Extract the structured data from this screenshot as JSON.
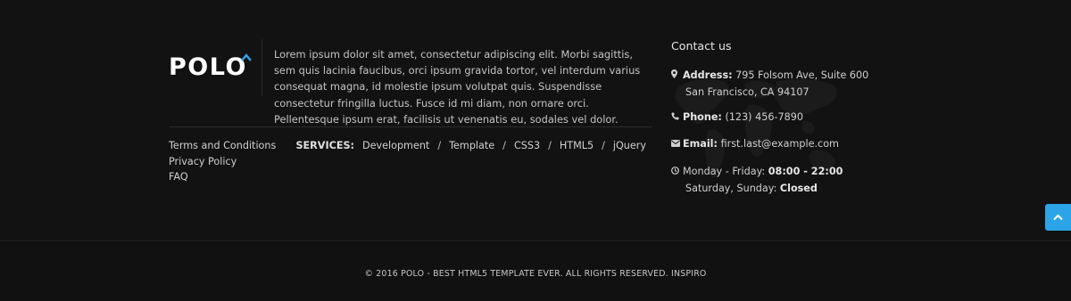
{
  "logo": {
    "text": "POLO",
    "accent_color": "#2ba5e8"
  },
  "about": {
    "text": "Lorem ipsum dolor sit amet, consectetur adipiscing elit. Morbi sagittis, sem quis lacinia faucibus, orci ipsum gravida tortor, vel interdum varius consequat magna, id molestie ipsum volutpat quis. Suspendisse consectetur fringilla luctus. Fusce id mi diam, non ornare orci. Pellentesque ipsum erat, facilisis ut venenatis eu, sodales vel dolor."
  },
  "links": [
    "Terms and Conditions",
    "Privacy Policy",
    "FAQ"
  ],
  "services": {
    "label": "SERVICES:",
    "items": [
      "Development",
      "Template",
      "CSS3",
      "HTML5",
      "jQuery"
    ],
    "separator": "/"
  },
  "contact": {
    "title": "Contact us",
    "address_label": "Address:",
    "address_line1": "795 Folsom Ave, Suite 600",
    "address_line2": "San Francisco, CA 94107",
    "phone_label": "Phone:",
    "phone": "(123) 456-7890",
    "email_label": "Email:",
    "email": "first.last@example.com",
    "hours_weekday_label": "Monday - Friday:",
    "hours_weekday": "08:00 - 22:00",
    "hours_weekend_label": "Saturday, Sunday:",
    "hours_weekend": "Closed",
    "icons": [
      "map-marker-icon",
      "phone-icon",
      "envelope-icon",
      "clock-icon"
    ]
  },
  "scroll_top": {
    "icon": "chevron-up-icon",
    "color": "#2ba5e8"
  },
  "copyright": "© 2016 POLO - BEST HTML5 TEMPLATE EVER. ALL RIGHTS RESERVED. INSPIRO"
}
